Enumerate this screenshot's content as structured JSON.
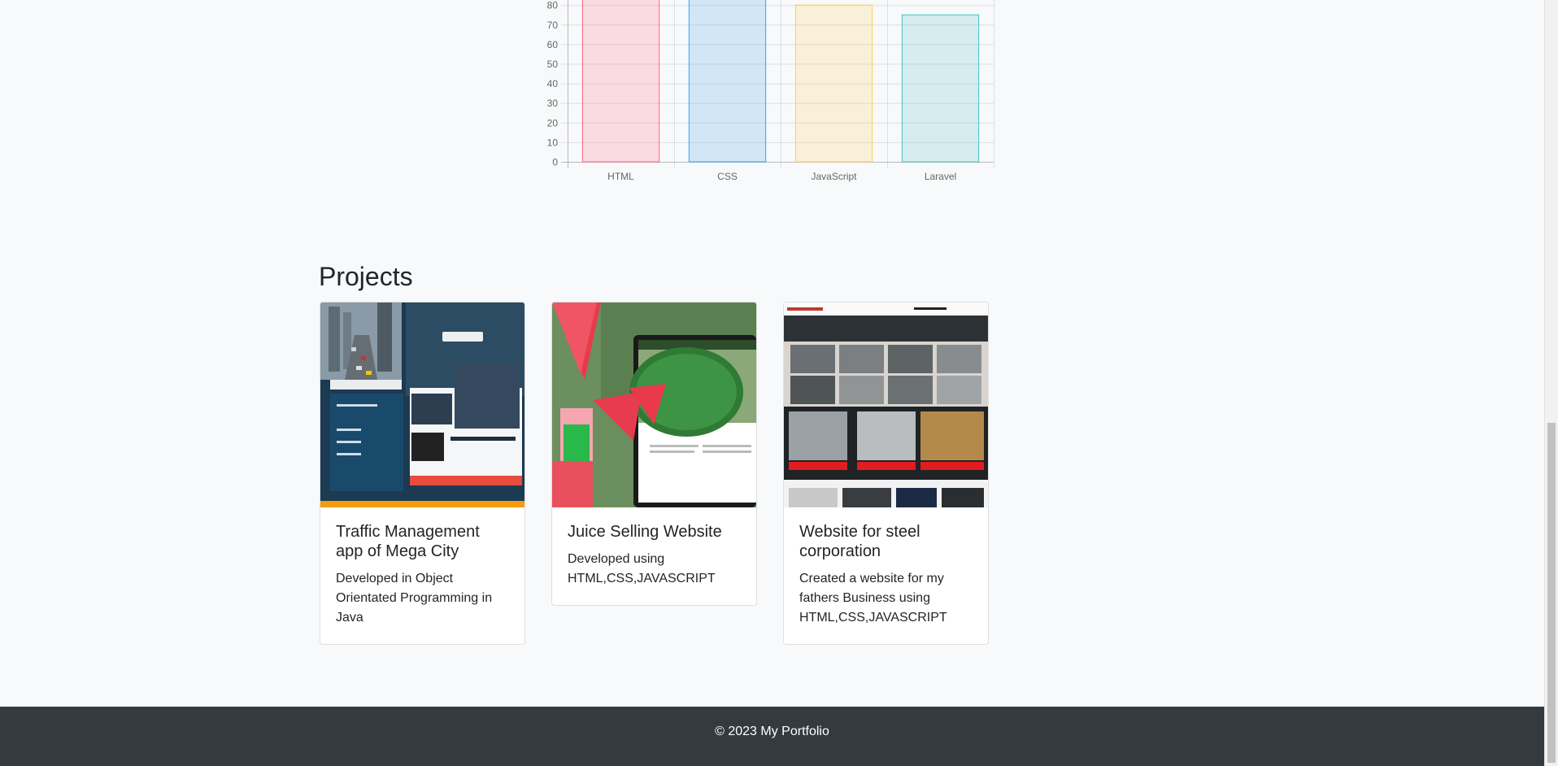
{
  "chart_data": {
    "type": "bar",
    "categories": [
      "HTML",
      "CSS",
      "JavaScript",
      "Laravel"
    ],
    "values": [
      90,
      85,
      80,
      75
    ],
    "ylim": [
      0,
      90
    ],
    "yticks": [
      0,
      10,
      20,
      30,
      40,
      50,
      60,
      70,
      80
    ],
    "grid": true,
    "colors": {
      "fill": [
        "rgba(255,99,132,0.2)",
        "rgba(54,162,235,0.2)",
        "rgba(255,206,86,0.2)",
        "rgba(75,192,192,0.2)"
      ],
      "stroke": [
        "#ff6384",
        "#36a2eb",
        "#ffce56",
        "#4bc0c0"
      ]
    }
  },
  "projects": {
    "title": "Projects",
    "items": [
      {
        "title": "Traffic Management app of Mega City",
        "text": "Developed in Object Orientated Programming in Java"
      },
      {
        "title": "Juice Selling Website",
        "text": "Developed using HTML,CSS,JAVASCRIPT"
      },
      {
        "title": "Website for steel corporation",
        "text": "Created a website for my fathers Business using HTML,CSS,JAVASCRIPT"
      }
    ]
  },
  "footer": {
    "text": "© 2023 My Portfolio"
  }
}
